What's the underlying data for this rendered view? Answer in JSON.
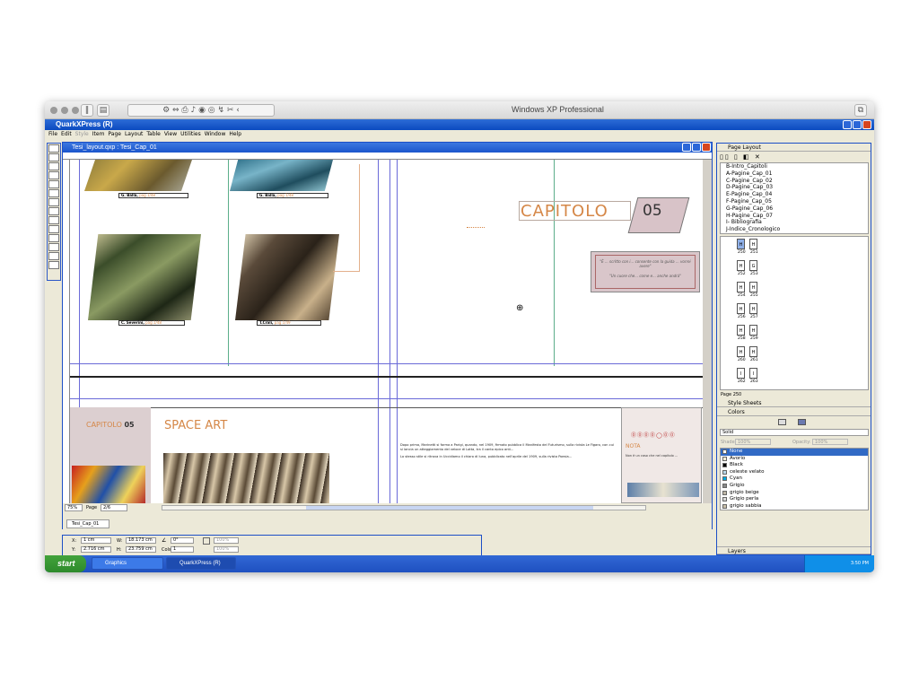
{
  "host": {
    "title": "Windows XP Professional"
  },
  "app": {
    "title": "QuarkXPress (R)",
    "menu": [
      "File",
      "Edit",
      "Style",
      "Item",
      "Page",
      "Layout",
      "Table",
      "View",
      "Utilities",
      "Window",
      "Help"
    ]
  },
  "document": {
    "title": "Tesi_layout.qxp : Tesi_Cap_01",
    "zoom": "75%",
    "page_label": "Page",
    "page_value": "2/6",
    "layout_tab": "Tesi_Cap_01",
    "captions": [
      {
        "name": "G. Balla,",
        "ref": "pag.1/48"
      },
      {
        "name": "G. Balla,",
        "ref": "pag.1/48"
      },
      {
        "name": "C. Severini,",
        "ref": "pag.1/48"
      },
      {
        "name": "T.Crali,",
        "ref": "pag.1/49"
      }
    ],
    "chapter_title": "CAPITOLO",
    "chapter_number": "05",
    "quote_1": "\"È ... scritto con i... consente con la guida ... vorrei avere\"",
    "quote_2": "\"Un cuore che... come e... anche andrà\"",
    "lower_chapter": "CAPITOLO",
    "lower_chapter_num": "05",
    "section_title": "SPACE ART",
    "nota_label": "NOTA",
    "body_text_1": "Dopo prima, Marinetti si forma a Parigi, quando, nel 1909, firmato pubblica il Manifesto del Futurismo, sulla rivista Le Figaro, con cui si lancia un atteggiamento del veloce di Lotta, tra il canto epico anti...",
    "body_text_2": "Lo stesso stile si ritrova in Uccidiamo il chiaro di luna, pubblicato nell'aprile del 1909, sulla rivista Poesia...",
    "nota_text": "Non è un caso che nel capitolo ..."
  },
  "measurements": {
    "x_label": "X:",
    "x_value": "1 cm",
    "y_label": "Y:",
    "y_value": "2.716 cm",
    "w_label": "W:",
    "w_value": "18.173 cm",
    "h_label": "H:",
    "h_value": "23.759 cm",
    "angle_value": "0°",
    "cols_label": "Cols:",
    "cols_value": "1",
    "opacity_1": "100%",
    "opacity_2": "100%"
  },
  "page_layout": {
    "title": "Page Layout",
    "masters": [
      "B-Intro_Capitoli",
      "A-Pagine_Cap_01",
      "C-Pagine_Cap_02",
      "D-Pagine_Cap_03",
      "E-Pagine_Cap_04",
      "F-Pagine_Cap_05",
      "G-Pagine_Cap_06",
      "H-Pagine_Cap_07",
      "I- Bibliografia",
      "J-Indice_Cronologico"
    ],
    "spreads": [
      {
        "l": "H",
        "r": "H",
        "ln": "250",
        "rn": "251"
      },
      {
        "l": "H",
        "r": "G",
        "ln": "252",
        "rn": "253"
      },
      {
        "l": "H",
        "r": "H",
        "ln": "254",
        "rn": "255"
      },
      {
        "l": "H",
        "r": "H",
        "ln": "256",
        "rn": "257"
      },
      {
        "l": "H",
        "r": "H",
        "ln": "258",
        "rn": "259"
      },
      {
        "l": "H",
        "r": "H",
        "ln": "260",
        "rn": "261"
      },
      {
        "l": "I",
        "r": "I",
        "ln": "262",
        "rn": "263"
      }
    ],
    "page_indicator": "Page 250"
  },
  "style_sheets": {
    "title": "Style Sheets"
  },
  "colors_panel": {
    "title": "Colors",
    "mode": "Solid",
    "shade_label": "Shade:",
    "shade_value": "100%",
    "opacity_label": "Opacity:",
    "opacity_value": "100%",
    "items": [
      {
        "name": "None",
        "color": "#ffffff",
        "selected": true
      },
      {
        "name": "Avorio",
        "color": "#f3ecd6",
        "selected": false
      },
      {
        "name": "Black",
        "color": "#000000",
        "selected": false
      },
      {
        "name": "celeste velato",
        "color": "#b9d6e8",
        "selected": false
      },
      {
        "name": "Cyan",
        "color": "#00a8e0",
        "selected": false
      },
      {
        "name": "Grigio",
        "color": "#888888",
        "selected": false
      },
      {
        "name": "grigio beige",
        "color": "#bdb6a6",
        "selected": false
      },
      {
        "name": "Grigio perla",
        "color": "#d8d8d8",
        "selected": false
      },
      {
        "name": "grigio sabbia",
        "color": "#c9c0aa",
        "selected": false
      }
    ]
  },
  "layers": {
    "title": "Layers"
  },
  "taskbar": {
    "start": "start",
    "tasks": [
      "Graphics",
      "QuarkXPress (R)"
    ],
    "clock": "3:50 PM"
  },
  "accent_color": "#d58747"
}
